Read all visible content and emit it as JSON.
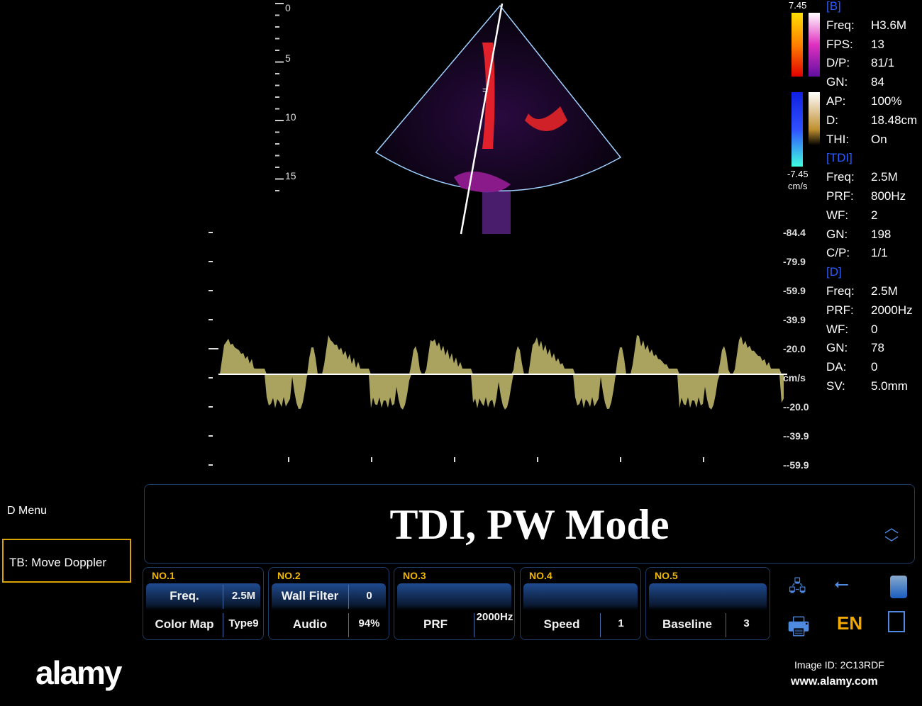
{
  "depth_scale": [
    "0",
    "5",
    "10",
    "15"
  ],
  "color_bar": {
    "max": "7.45",
    "min": "-7.45",
    "unit": "cm/s"
  },
  "params": [
    {
      "section": "[B]"
    },
    {
      "k": "Freq:",
      "v": "H3.6M"
    },
    {
      "k": "FPS:",
      "v": "13"
    },
    {
      "k": "D/P:",
      "v": "81/1"
    },
    {
      "k": "GN:",
      "v": "84"
    },
    {
      "k": "AP:",
      "v": "100%"
    },
    {
      "k": "D:",
      "v": "18.48cm"
    },
    {
      "k": "THI:",
      "v": "On"
    },
    {
      "section": "[TDI]"
    },
    {
      "k": "Freq:",
      "v": "2.5M"
    },
    {
      "k": "PRF:",
      "v": "800Hz"
    },
    {
      "k": "WF:",
      "v": "2"
    },
    {
      "k": "GN:",
      "v": "198"
    },
    {
      "k": "C/P:",
      "v": "1/1"
    },
    {
      "section": "[D]"
    },
    {
      "k": "Freq:",
      "v": "2.5M"
    },
    {
      "k": "PRF:",
      "v": "2000Hz"
    },
    {
      "k": "WF:",
      "v": "0"
    },
    {
      "k": "GN:",
      "v": "78"
    },
    {
      "k": "DA:",
      "v": "0"
    },
    {
      "k": "SV:",
      "v": "5.0mm"
    }
  ],
  "velocity_scale": [
    "-84.4",
    "-79.9",
    "-59.9",
    "-39.9",
    "-20.0",
    "cm/s",
    "--20.0",
    "--39.9",
    "--59.9"
  ],
  "menu": {
    "title": "D Menu",
    "hint": "TB: Move Doppler"
  },
  "mode_title": "TDI, PW Mode",
  "groups": [
    {
      "no": "NO.1",
      "r1": [
        "Freq.",
        "2.5M"
      ],
      "r2": [
        "Color Map",
        "Type9"
      ]
    },
    {
      "no": "NO.2",
      "r1": [
        "Wall Filter",
        "0"
      ],
      "r2": [
        "Audio",
        "94%"
      ]
    },
    {
      "no": "NO.3",
      "r1": null,
      "r2": [
        "PRF",
        "2000Hz"
      ]
    },
    {
      "no": "NO.4",
      "r1": null,
      "r2": [
        "Speed",
        "1"
      ]
    },
    {
      "no": "NO.5",
      "r1": null,
      "r2": [
        "Baseline",
        "3"
      ]
    }
  ],
  "status": {
    "language": "EN"
  },
  "watermark": {
    "logo": "alamy",
    "image_id": "Image ID: 2C13RDF",
    "site": "www.alamy.com"
  },
  "colors": {
    "accent": "#f0b800",
    "panel_blue": "#1f4b8f",
    "section": "#2a5cff"
  }
}
